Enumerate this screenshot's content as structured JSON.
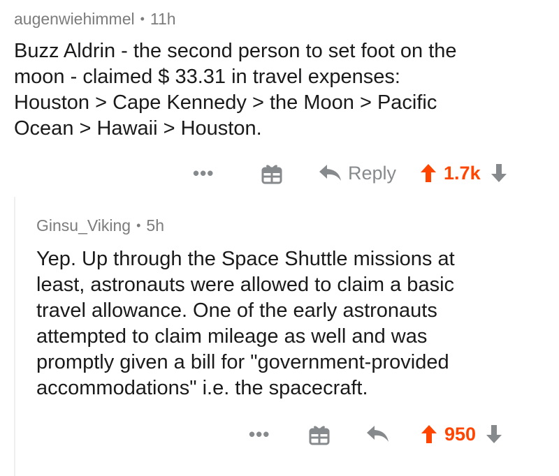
{
  "comment": {
    "username": "augenwiehimmel",
    "separator": "•",
    "age": "11h",
    "text_lines": [
      "Buzz Aldrin - the second person to set foot on the",
      "moon - claimed $ 33.31 in travel expenses:",
      "Houston > Cape Kennedy > the Moon > Pacific",
      "Ocean > Hawaii > Houston."
    ],
    "actions": {
      "more": "•••",
      "reply_label": "Reply",
      "score": "1.7k"
    }
  },
  "reply": {
    "username": "Ginsu_Viking",
    "separator": "•",
    "age": "5h",
    "text_lines": [
      "Yep. Up through the Space Shuttle missions at",
      "least, astronauts were allowed to claim a basic",
      "travel allowance. One of the early astronauts",
      "attempted to claim mileage as well and was",
      "promptly given a bill for \"government-provided",
      "accommodations\" i.e. the spacecraft."
    ],
    "actions": {
      "more": "•••",
      "score": "950"
    }
  },
  "colors": {
    "upvote": "#ff4500",
    "icon_gray": "#878a8c",
    "meta_gray": "#7c7c7c",
    "thread_line": "#edeff1"
  },
  "icons": [
    "more-icon",
    "gift-icon",
    "reply-arrow-icon",
    "upvote-arrow-icon",
    "downvote-arrow-icon"
  ]
}
